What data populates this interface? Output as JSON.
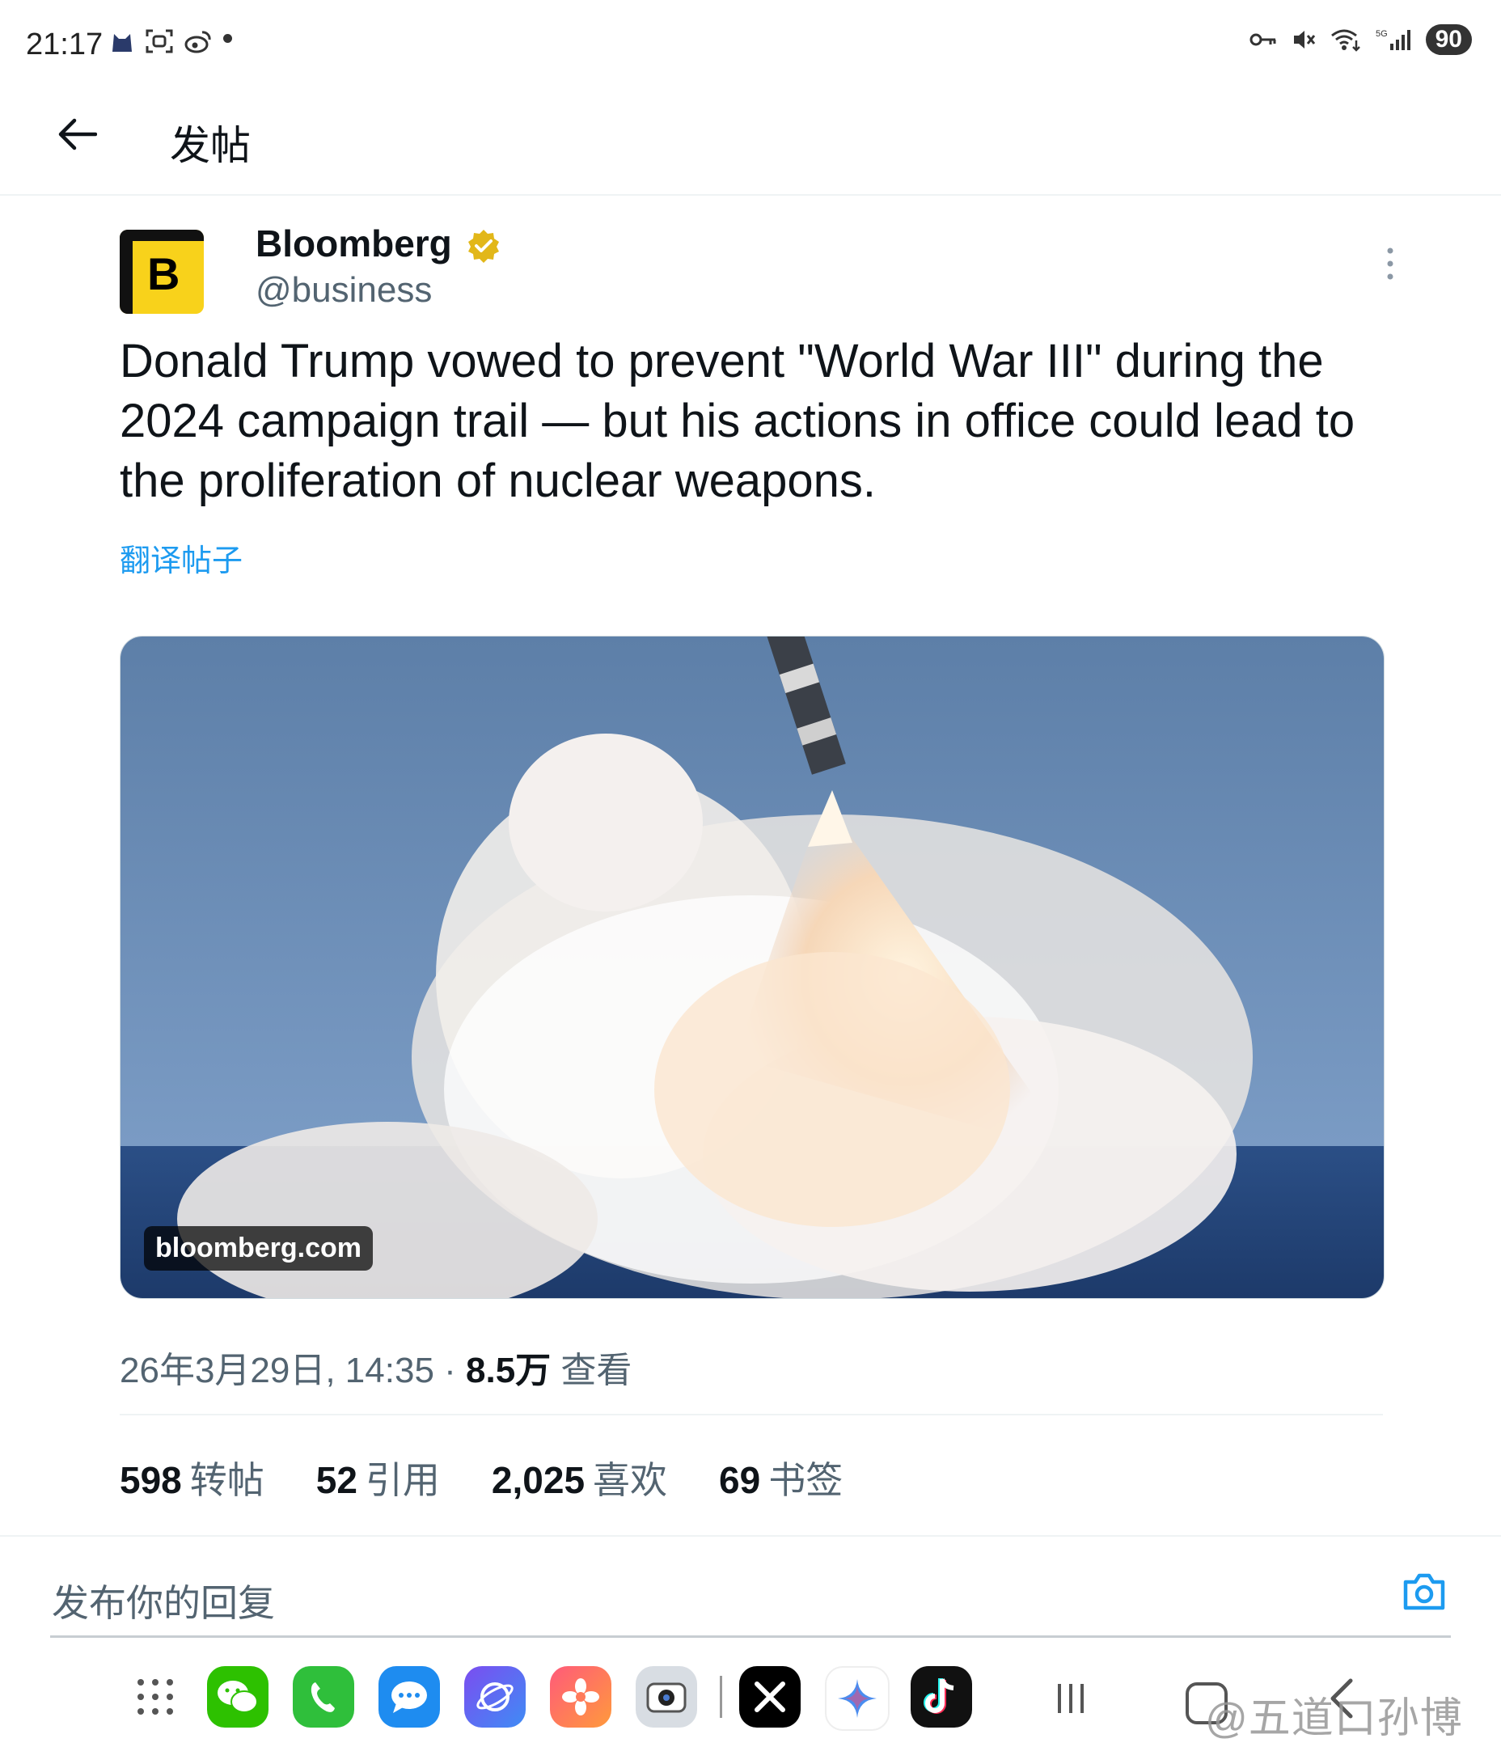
{
  "status_bar": {
    "time": "21:17",
    "battery": "90",
    "left_icons": [
      "cat-icon",
      "scan-icon",
      "weibo-icon"
    ],
    "right_icons": [
      "key-icon",
      "mute-icon",
      "wifi-icon",
      "signal-5g-icon"
    ]
  },
  "header": {
    "title": "发帖"
  },
  "tweet": {
    "author_name": "Bloomberg",
    "author_handle": "@business",
    "avatar_letter": "B",
    "text": "Donald Trump vowed to prevent \"World War III\" during the 2024 campaign trail — but his actions in office could lead to the proliferation of nuclear weapons.",
    "translate_label": "翻译帖子",
    "media_domain": "bloomberg.com",
    "timestamp": "26年3月29日, 14:35 · ",
    "views_count": "8.5万",
    "views_label": " 查看"
  },
  "stats": [
    {
      "count": "598",
      "label": "转帖"
    },
    {
      "count": "52",
      "label": "引用"
    },
    {
      "count": "2,025",
      "label": "喜欢"
    },
    {
      "count": "69",
      "label": "书签"
    }
  ],
  "reply": {
    "placeholder": "发布你的回复"
  },
  "dock": {
    "apps": [
      "wechat-icon",
      "phone-icon",
      "messages-icon",
      "browser-icon",
      "gallery-icon",
      "camera-app-icon",
      "x-icon",
      "gemini-icon",
      "tiktok-icon"
    ]
  },
  "watermark": "@五道口孙博",
  "colors": {
    "accent": "#1d9bf0",
    "text_primary": "#0f1419",
    "text_secondary": "#536471",
    "verified_gold": "#e2b719",
    "bloomberg_yellow": "#f8d21b"
  }
}
